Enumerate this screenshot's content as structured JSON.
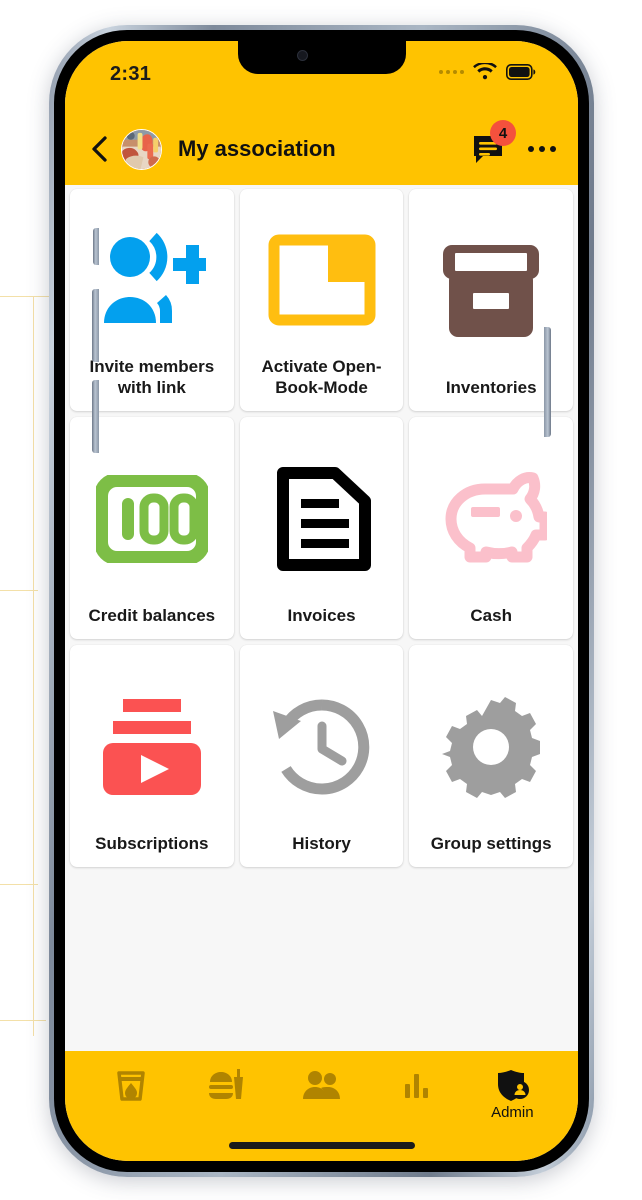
{
  "theme": {
    "brand_yellow": "#FFC300",
    "page_background": "#F7F7F7",
    "tile_background": "#FFFFFF",
    "badge_red": "#F4513D",
    "text_dark": "#191919",
    "nav_icon_inactive": "#B08400"
  },
  "status_bar": {
    "clock": "2:31",
    "signal_icon": "signal-dots-icon",
    "wifi_icon": "wifi-icon",
    "battery_icon": "battery-full-icon"
  },
  "app_bar": {
    "back_icon": "back-chevron-icon",
    "avatar_icon": "group-avatar-photo",
    "title": "My association",
    "chat_icon": "chat-bubble-icon",
    "chat_badge_count": "4",
    "overflow_icon": "more-options-icon"
  },
  "grid": {
    "rows": [
      [
        {
          "label": "Invite members with link",
          "icon": "invite-person-add-icon",
          "color": "#03A0EE"
        },
        {
          "label": "Activate Open-Book-Mode",
          "icon": "folder-open-icon",
          "color": "#FFBE10"
        },
        {
          "label": "Inventories",
          "icon": "archive-box-icon",
          "color": "#70514A"
        }
      ],
      [
        {
          "label": "Credit balances",
          "icon": "banknote-100-icon",
          "color": "#7DBE46"
        },
        {
          "label": "Invoices",
          "icon": "document-lines-icon",
          "color": "#000000"
        },
        {
          "label": "Cash",
          "icon": "piggy-bank-icon",
          "color": "#FBC0CB"
        }
      ],
      [
        {
          "label": "Subscriptions",
          "icon": "subscriptions-play-icon",
          "color": "#FB5252"
        },
        {
          "label": "History",
          "icon": "history-clock-icon",
          "color": "#9E9E9E"
        },
        {
          "label": "Group settings",
          "icon": "gear-settings-icon",
          "color": "#9E9E9E"
        }
      ]
    ]
  },
  "bottom_nav": {
    "items": [
      {
        "label": "",
        "icon": "drink-glass-icon",
        "active": false
      },
      {
        "label": "",
        "icon": "food-burger-drink-icon",
        "active": false
      },
      {
        "label": "",
        "icon": "people-group-icon",
        "active": false
      },
      {
        "label": "",
        "icon": "bar-chart-icon",
        "active": false
      },
      {
        "label": "Admin",
        "icon": "admin-shield-person-icon",
        "active": true
      }
    ]
  }
}
